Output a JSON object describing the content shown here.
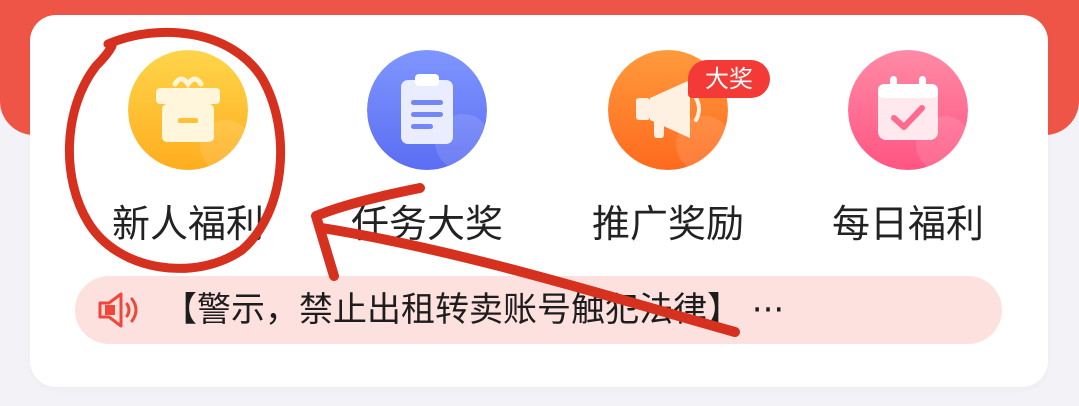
{
  "colors": {
    "header_background": "#ef5546",
    "card_background": "#ffffff",
    "page_background": "#f3f2f7",
    "notice_background": "#fde1df",
    "badge_background": "#f33a36",
    "annotation": "#d6301f"
  },
  "menu": {
    "items": [
      {
        "label": "新人福利",
        "icon": "gift-box-icon"
      },
      {
        "label": "任务大奖",
        "icon": "clipboard-icon"
      },
      {
        "label": "推广奖励",
        "icon": "megaphone-icon",
        "badge": "大奖"
      },
      {
        "label": "每日福利",
        "icon": "calendar-check-icon"
      }
    ]
  },
  "notice": {
    "icon": "speaker-icon",
    "text": "【警示，禁止出租转卖账号触犯法律】 ···"
  }
}
